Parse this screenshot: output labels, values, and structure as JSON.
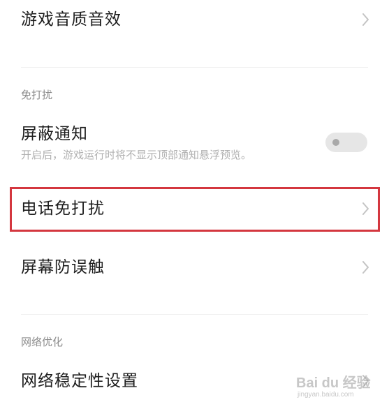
{
  "items": {
    "game_audio": {
      "title": "游戏音质音效"
    },
    "block_notifications": {
      "title": "屏蔽通知",
      "subtitle": "开启后，游戏运行时将不显示顶部通知悬浮预览。",
      "toggle_on": false
    },
    "call_dnd": {
      "title": "电话免打扰"
    },
    "screen_mistouch": {
      "title": "屏幕防误触"
    },
    "network_stability": {
      "title": "网络稳定性设置"
    }
  },
  "sections": {
    "dnd": {
      "label": "免打扰"
    },
    "network": {
      "label": "网络优化"
    }
  },
  "icons": {
    "chevron": "chevron-right-icon"
  },
  "colors": {
    "highlight_border": "#d4373f",
    "toggle_track": "#e6e6e6",
    "toggle_knob": "#a9a9a9"
  },
  "watermark": {
    "text": "Bai du 经验",
    "url": "jingyan.baidu.com"
  }
}
